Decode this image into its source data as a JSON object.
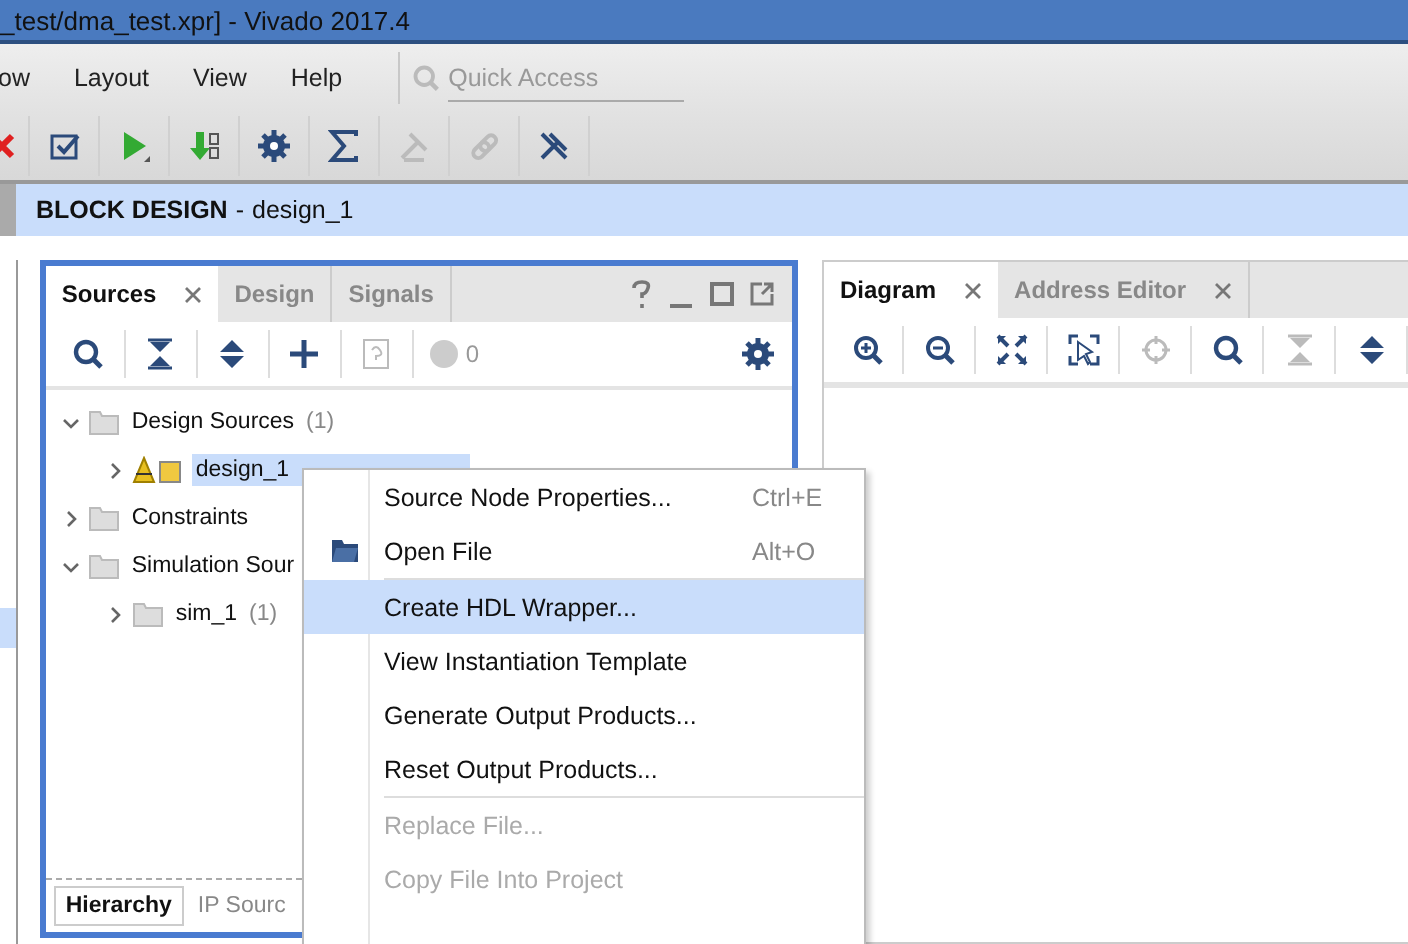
{
  "window": {
    "title": "_test/dma_test.xpr] - Vivado 2017.4"
  },
  "menu_bar": {
    "items": [
      {
        "label": "ow"
      },
      {
        "label": "Layout"
      },
      {
        "label": "View"
      },
      {
        "label": "Help"
      }
    ],
    "search": {
      "placeholder": "Quick Access"
    }
  },
  "toolbar": [
    {
      "kind": "cancel",
      "disabled": false
    },
    {
      "kind": "check",
      "disabled": false
    },
    {
      "kind": "run",
      "disabled": false
    },
    {
      "kind": "bitstream",
      "disabled": false
    },
    {
      "kind": "gear",
      "disabled": false
    },
    {
      "kind": "sigma",
      "disabled": false
    },
    {
      "kind": "probe",
      "disabled": true
    },
    {
      "kind": "link",
      "disabled": true
    },
    {
      "kind": "unlink",
      "disabled": false
    }
  ],
  "editor_header": {
    "kind": "BLOCK DESIGN",
    "separator": "-",
    "name": "design_1"
  },
  "sources_panel": {
    "tabs": [
      {
        "label": "Sources",
        "selected": true
      },
      {
        "label": "Design",
        "selected": false
      },
      {
        "label": "Signals",
        "selected": false
      }
    ],
    "toolbar": [
      {
        "kind": "search",
        "disabled": false
      },
      {
        "kind": "collapse",
        "disabled": false
      },
      {
        "kind": "expand",
        "disabled": false
      },
      {
        "kind": "add",
        "disabled": false
      },
      {
        "kind": "help",
        "disabled": true
      },
      {
        "kind": "gear",
        "disabled": false
      }
    ],
    "messages_count": "0",
    "tree": [
      {
        "label": "Design Sources",
        "count": "(1)",
        "kind": "folder",
        "expanded": true,
        "selected": false,
        "children": [
          {
            "label": "design_1",
            "kind": "block",
            "expanded": false,
            "selected": true
          }
        ]
      },
      {
        "label": "Constraints",
        "kind": "folder",
        "expanded": false,
        "selected": false
      },
      {
        "label": "Simulation Sour",
        "kind": "folder",
        "expanded": true,
        "selected": false,
        "children": [
          {
            "label": "sim_1",
            "count": "(1)",
            "kind": "folder",
            "expanded": false,
            "selected": false
          }
        ]
      }
    ],
    "bottom_tabs": [
      {
        "label": "Hierarchy",
        "selected": true
      },
      {
        "label": "IP Sourc",
        "selected": false
      }
    ]
  },
  "diagram_panel": {
    "tabs": [
      {
        "label": "Diagram",
        "selected": true
      },
      {
        "label": "Address Editor",
        "selected": false
      }
    ],
    "toolbar": [
      {
        "kind": "zoom-in",
        "disabled": false
      },
      {
        "kind": "zoom-out",
        "disabled": false
      },
      {
        "kind": "fit",
        "disabled": false
      },
      {
        "kind": "select-area",
        "disabled": false
      },
      {
        "kind": "crosshair",
        "disabled": true
      },
      {
        "kind": "search",
        "disabled": false
      },
      {
        "kind": "collapse",
        "disabled": true
      },
      {
        "kind": "expand",
        "disabled": false
      }
    ]
  },
  "context_menu": {
    "items": [
      {
        "label": "Source Node Properties...",
        "shortcut": "Ctrl+E",
        "disabled": false,
        "selected": false
      },
      {
        "label": "Open File",
        "shortcut": "Alt+O",
        "kind": "open",
        "disabled": false,
        "selected": false
      },
      {
        "kind": "separator"
      },
      {
        "label": "Create HDL Wrapper...",
        "disabled": false,
        "selected": true
      },
      {
        "label": "View Instantiation Template",
        "disabled": false,
        "selected": false
      },
      {
        "label": "Generate Output Products...",
        "disabled": false,
        "selected": false
      },
      {
        "label": "Reset Output Products...",
        "disabled": false,
        "selected": false
      },
      {
        "kind": "separator"
      },
      {
        "label": "Replace File...",
        "disabled": true,
        "selected": false
      },
      {
        "label": "Copy File Into Project",
        "disabled": true,
        "selected": false
      }
    ]
  }
}
